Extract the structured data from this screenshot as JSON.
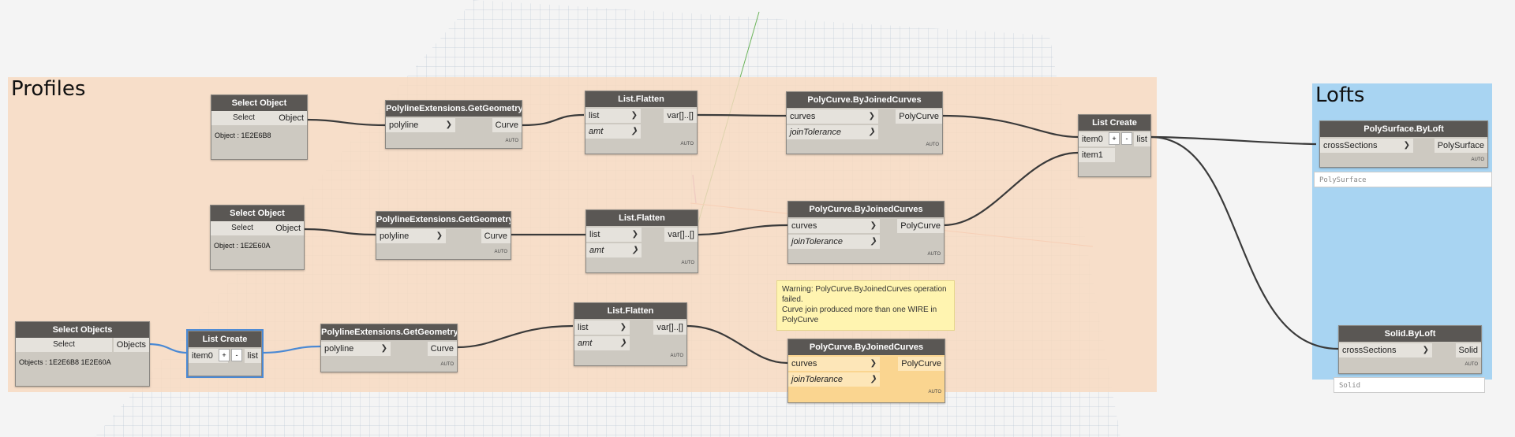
{
  "groups": {
    "profiles": {
      "title": "Profiles"
    },
    "lofts": {
      "title": "Lofts"
    }
  },
  "colors": {
    "profiles_group": "#f8d9c0",
    "lofts_group": "#a8d4f2",
    "node_header": "#5a5754",
    "node_body": "#cdc9c1",
    "warning_node": "#fad590",
    "selection": "#4a89d4"
  },
  "nodes": {
    "select_object_1": {
      "title": "Select Object",
      "button": "Select",
      "output": "Object",
      "value": "Object : 1E2E6B8"
    },
    "select_object_2": {
      "title": "Select Object",
      "button": "Select",
      "output": "Object",
      "value": "Object : 1E2E60A"
    },
    "select_objects": {
      "title": "Select Objects",
      "button": "Select",
      "output": "Objects",
      "value": "Objects : 1E2E6B8 1E2E60A"
    },
    "list_create_small": {
      "title": "List Create",
      "input": "item0",
      "plus": "+",
      "minus": "-",
      "output": "list"
    },
    "get_geometry_1": {
      "title": "PolylineExtensions.GetGeometry",
      "input": "polyline",
      "output": "Curve",
      "footer": "AUTO"
    },
    "get_geometry_2": {
      "title": "PolylineExtensions.GetGeometry",
      "input": "polyline",
      "output": "Curve",
      "footer": "AUTO"
    },
    "get_geometry_3": {
      "title": "PolylineExtensions.GetGeometry",
      "input": "polyline",
      "output": "Curve",
      "footer": "AUTO"
    },
    "flatten_1": {
      "title": "List.Flatten",
      "input1": "list",
      "input2": "amt",
      "output": "var[]..[]",
      "footer": "AUTO"
    },
    "flatten_2": {
      "title": "List.Flatten",
      "input1": "list",
      "input2": "amt",
      "output": "var[]..[]",
      "footer": "AUTO"
    },
    "flatten_3": {
      "title": "List.Flatten",
      "input1": "list",
      "input2": "amt",
      "output": "var[]..[]",
      "footer": "AUTO"
    },
    "polycurve_1": {
      "title": "PolyCurve.ByJoinedCurves",
      "input1": "curves",
      "input2": "joinTolerance",
      "output": "PolyCurve",
      "footer": "AUTO"
    },
    "polycurve_2": {
      "title": "PolyCurve.ByJoinedCurves",
      "input1": "curves",
      "input2": "joinTolerance",
      "output": "PolyCurve",
      "footer": "AUTO"
    },
    "polycurve_3": {
      "title": "PolyCurve.ByJoinedCurves",
      "input1": "curves",
      "input2": "joinTolerance",
      "output": "PolyCurve",
      "footer": "AUTO"
    },
    "list_create_main": {
      "title": "List Create",
      "input1": "item0",
      "input2": "item1",
      "plus": "+",
      "minus": "-",
      "output": "list"
    },
    "polysurface_byloft": {
      "title": "PolySurface.ByLoft",
      "input": "crossSections",
      "output": "PolySurface",
      "footer": "AUTO",
      "preview": "PolySurface"
    },
    "solid_byloft": {
      "title": "Solid.ByLoft",
      "input": "crossSections",
      "output": "Solid",
      "footer": "AUTO",
      "preview": "Solid"
    }
  },
  "warning": {
    "line1": "Warning: PolyCurve.ByJoinedCurves operation",
    "line2": "failed.",
    "line3": "Curve join produced more than one WIRE in",
    "line4": "PolyCurve"
  }
}
